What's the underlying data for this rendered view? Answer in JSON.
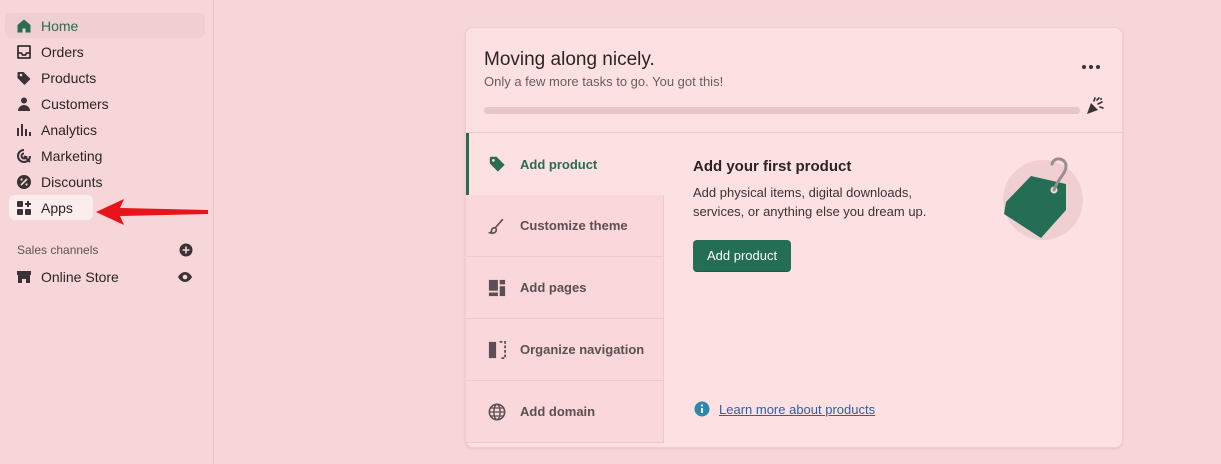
{
  "sidebar": {
    "items": [
      {
        "label": "Home",
        "icon": "home-icon"
      },
      {
        "label": "Orders",
        "icon": "inbox-icon"
      },
      {
        "label": "Products",
        "icon": "tag-icon"
      },
      {
        "label": "Customers",
        "icon": "person-icon"
      },
      {
        "label": "Analytics",
        "icon": "bar-chart-icon"
      },
      {
        "label": "Marketing",
        "icon": "target-icon"
      },
      {
        "label": "Discounts",
        "icon": "percent-icon"
      },
      {
        "label": "Apps",
        "icon": "apps-grid-icon"
      }
    ],
    "sales_channels": {
      "title": "Sales channels",
      "items": [
        {
          "label": "Online Store",
          "icon": "store-icon"
        }
      ]
    }
  },
  "setup_card": {
    "title": "Moving along nicely.",
    "subtitle": "Only a few more tasks to go. You got this!",
    "progress_fraction": 0,
    "tasks": [
      {
        "label": "Add product",
        "icon": "tag-icon"
      },
      {
        "label": "Customize theme",
        "icon": "brush-icon"
      },
      {
        "label": "Add pages",
        "icon": "pages-icon"
      },
      {
        "label": "Organize navigation",
        "icon": "navigation-icon"
      },
      {
        "label": "Add domain",
        "icon": "globe-icon"
      }
    ],
    "detail": {
      "title": "Add your first product",
      "description": "Add physical items, digital downloads, services, or anything else you dream up.",
      "button_label": "Add product",
      "learn_more": "Learn more about products"
    }
  },
  "colors": {
    "background": "#f6d6d8",
    "card": "#fde0e2",
    "accent": "#236e54",
    "link": "#2f5fa5",
    "annotation_arrow": "#e8141b"
  }
}
